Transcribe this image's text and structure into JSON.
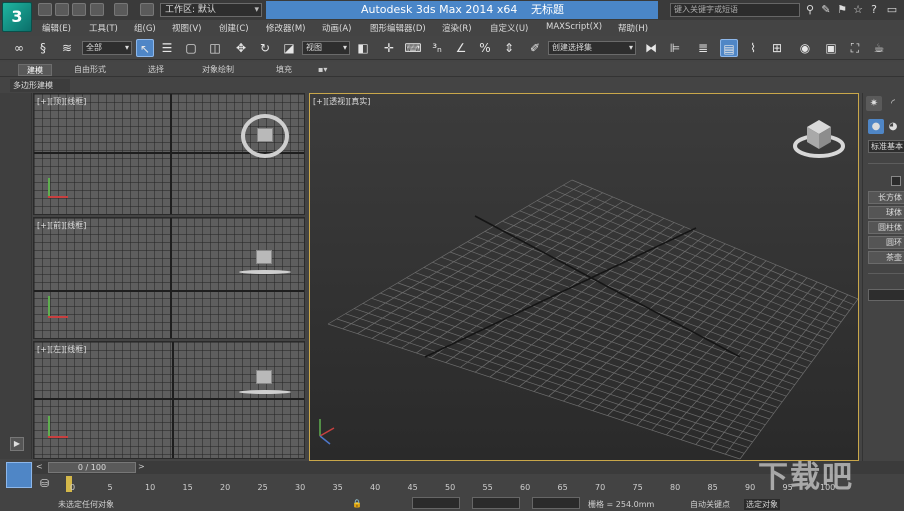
{
  "title_bar": {
    "app_title": "Autodesk 3ds Max  2014 x64",
    "doc_title": "无标题",
    "workspace_select": "工作区: 默认",
    "search_placeholder": "键入关键字或短语"
  },
  "menu": [
    "编辑(E)",
    "工具(T)",
    "组(G)",
    "视图(V)",
    "创建(C)",
    "修改器(M)",
    "动画(A)",
    "图形编辑器(D)",
    "渲染(R)",
    "自定义(U)",
    "MAXScript(X)",
    "帮助(H)"
  ],
  "toolbar": {
    "selection_filter": "全部",
    "reference_coord": "视图",
    "named_selection": "创建选择集"
  },
  "ribbon": {
    "tabs": [
      "建模",
      "自由形式",
      "选择",
      "对象绘制",
      "填充"
    ],
    "sub_label": "多边形建模"
  },
  "viewports": {
    "top": "[+][顶][线框]",
    "front": "[+][前][线框]",
    "left": "[+][左][线框]",
    "perspective": "[+][透视][真实]"
  },
  "command_panel": {
    "category": "标准基本",
    "buttons": [
      "长方体",
      "球体",
      "圆柱体",
      "圆环",
      "茶壶"
    ]
  },
  "timeline": {
    "slider": "0 / 100",
    "ticks": [
      "0",
      "5",
      "10",
      "15",
      "20",
      "25",
      "30",
      "35",
      "40",
      "45",
      "50",
      "55",
      "60",
      "65",
      "70",
      "75",
      "80",
      "85",
      "90",
      "95",
      "100"
    ]
  },
  "status": {
    "message": "未选定任何对象",
    "grid": "栅格 = 254.0mm",
    "autokey": "自动关键点",
    "selected_mode": "选定对象"
  },
  "watermark": "下载吧",
  "colors": {
    "title_highlight": "#4a86c8",
    "active_viewport_border": "#c9a74a",
    "active_tool": "#4f86c6"
  }
}
